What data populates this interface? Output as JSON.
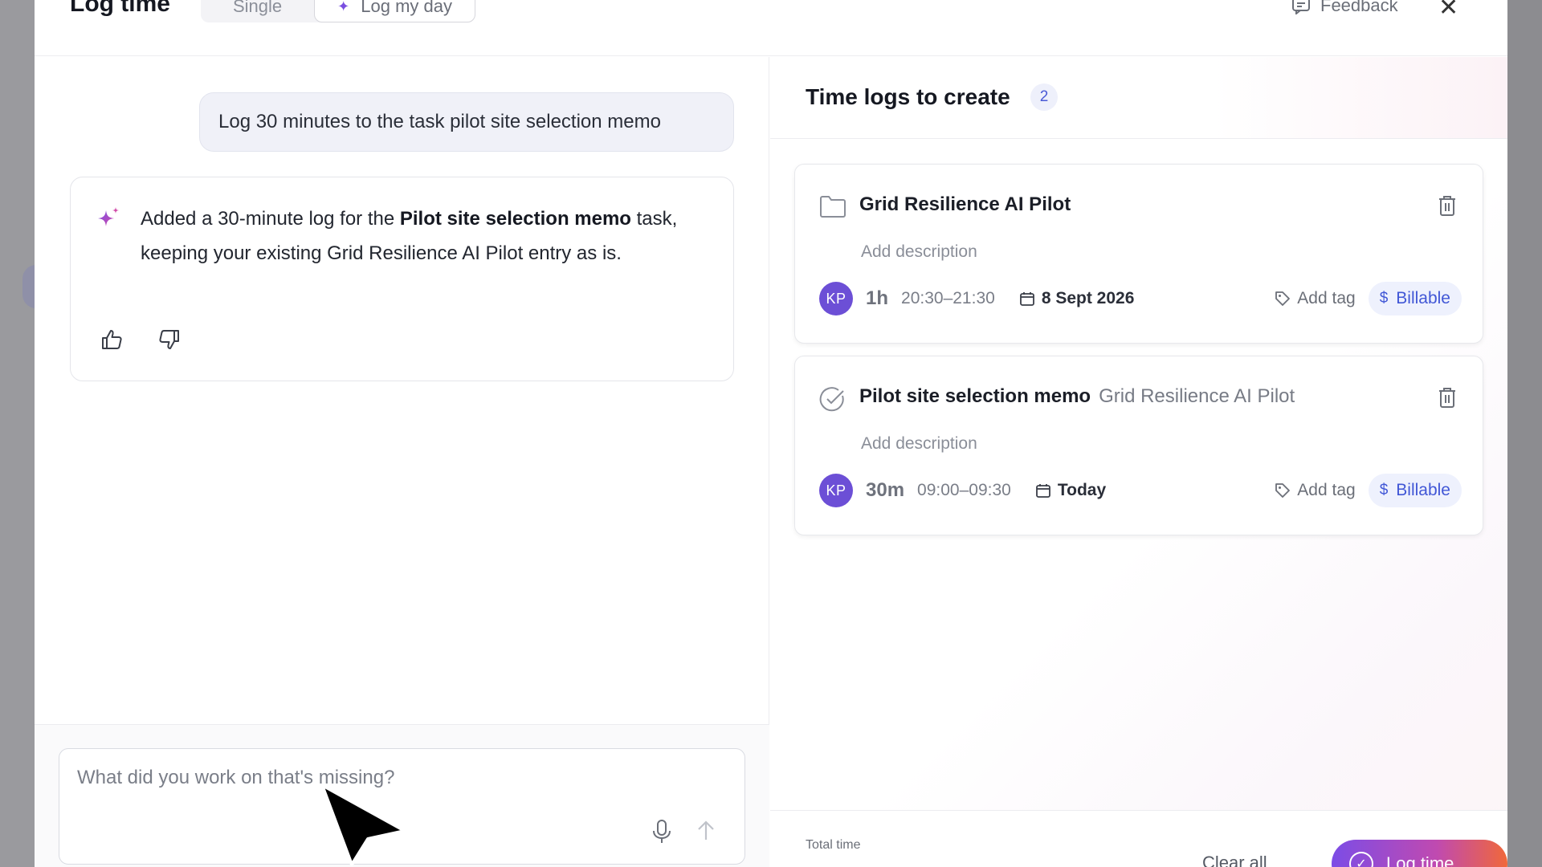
{
  "header": {
    "title": "Log time",
    "tabs": [
      {
        "label": "Single"
      },
      {
        "label": "Log my day"
      }
    ],
    "feedback_label": "Feedback"
  },
  "chat": {
    "user_message": "Log 30 minutes to the task pilot site selection memo",
    "ai_message": {
      "part1": "Added a 30-minute log for the ",
      "bold": "Pilot site selection memo",
      "part2": " task, keeping your existing Grid Resilience AI Pilot entry as is."
    },
    "composer_placeholder": "What did you work on that's missing?"
  },
  "time_logs": {
    "title": "Time logs to create",
    "count": "2",
    "entries": [
      {
        "title": "Grid Resilience AI Pilot",
        "subtitle": "",
        "icon": "folder-icon",
        "description_placeholder": "Add description",
        "avatar": "KP",
        "duration": "1h",
        "range": "20:30–21:30",
        "date": "8 Sept 2026",
        "tag_label": "Add tag",
        "billable_label": "Billable"
      },
      {
        "title": "Pilot site selection memo",
        "subtitle": "Grid Resilience AI Pilot",
        "icon": "task-check-icon",
        "description_placeholder": "Add description",
        "avatar": "KP",
        "duration": "30m",
        "range": "09:00–09:30",
        "date": "Today",
        "tag_label": "Add tag",
        "billable_label": "Billable"
      }
    ]
  },
  "footer": {
    "total_label": "Total time",
    "clear_label": "Clear all",
    "submit_label": "Log time"
  },
  "colors": {
    "accent": "#6c4fd6",
    "billable_bg": "#eef1fd",
    "billable_text": "#4157d6"
  }
}
